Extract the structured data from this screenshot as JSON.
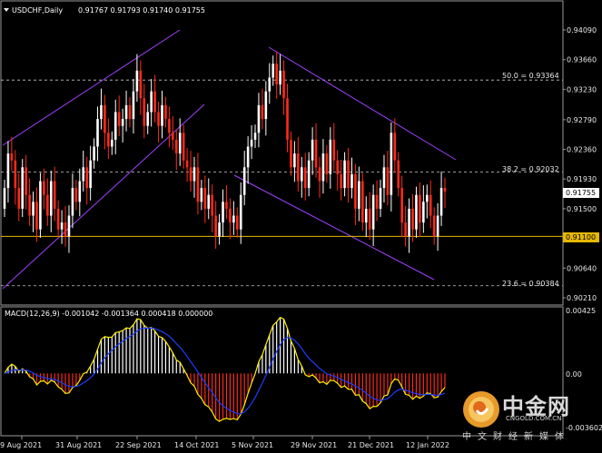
{
  "header": {
    "symbol": "USDCHF,Daily",
    "ohlc": "0.91767 0.91793 0.91740 0.91755",
    "collapse_icon": "triangle-down-icon"
  },
  "macd": {
    "label": "MACD(12,26,9) -0.001042 -0.001364 0.000418 0.000000",
    "scale_top": "0.00425",
    "scale_zero": "0.00",
    "scale_bottom": "-0.003602"
  },
  "fib": {
    "f50": "50.0 = 0.93364",
    "f38": "38.2 = 0.92032",
    "f23": "23.6 = 0.90384"
  },
  "price_axis": [
    "0.94090",
    "0.93660",
    "0.93230",
    "0.92790",
    "0.92360",
    "0.91930",
    "0.91500",
    "0.91060",
    "0.90640",
    "0.90210"
  ],
  "current_price": "0.91755",
  "support_price": "0.91100",
  "date_axis": [
    "9 Aug 2021",
    "31 Aug 2021",
    "22 Sep 2021",
    "14 Oct 2021",
    "5 Nov 2021",
    "29 Nov 2021",
    "21 Dec 2021",
    "12 Jan 2022"
  ],
  "colors": {
    "background": "#000000",
    "bull": "#ffffff",
    "bear": "#ff2a1a",
    "channel": "#a040ff",
    "support": "#e6b800",
    "macd_line": "#ffee00",
    "signal_line": "#1c3cff",
    "grid": "#c8c8c8"
  },
  "watermark": {
    "title": "中金网",
    "url": "CNGOLD.COM.CN",
    "subtitle": "中文财经新媒体"
  },
  "chart_data": {
    "type": "candlestick",
    "series": [
      {
        "name": "USDCHF,Daily",
        "close": [
          0.918,
          0.923,
          0.922,
          0.918,
          0.915,
          0.921,
          0.917,
          0.914,
          0.916,
          0.912,
          0.919,
          0.917,
          0.914,
          0.919,
          0.915,
          0.912,
          0.913,
          0.911,
          0.914,
          0.918,
          0.916,
          0.919,
          0.921,
          0.918,
          0.922,
          0.924,
          0.928,
          0.93,
          0.926,
          0.924,
          0.925,
          0.929,
          0.927,
          0.928,
          0.93,
          0.928,
          0.932,
          0.935,
          0.931,
          0.927,
          0.929,
          0.932,
          0.929,
          0.927,
          0.93,
          0.928,
          0.926,
          0.925,
          0.923,
          0.926,
          0.922,
          0.921,
          0.919,
          0.921,
          0.916,
          0.918,
          0.915,
          0.917,
          0.914,
          0.911,
          0.913,
          0.916,
          0.915,
          0.913,
          0.914,
          0.912,
          0.917,
          0.921,
          0.924,
          0.925,
          0.926,
          0.93,
          0.928,
          0.932,
          0.934,
          0.936,
          0.933,
          0.935,
          0.931,
          0.925,
          0.921,
          0.923,
          0.919,
          0.921,
          0.918,
          0.922,
          0.925,
          0.921,
          0.919,
          0.923,
          0.92,
          0.925,
          0.922,
          0.92,
          0.918,
          0.922,
          0.918,
          0.92,
          0.915,
          0.919,
          0.913,
          0.915,
          0.912,
          0.917,
          0.915,
          0.918,
          0.921,
          0.917,
          0.926,
          0.922,
          0.918,
          0.913,
          0.911,
          0.915,
          0.912,
          0.917,
          0.913,
          0.916,
          0.917,
          0.914,
          0.911,
          0.914,
          0.918,
          0.9175
        ]
      }
    ],
    "fibonacci_levels": [
      {
        "label": "50.0",
        "value": 0.93364
      },
      {
        "label": "38.2",
        "value": 0.92032
      },
      {
        "label": "23.6",
        "value": 0.90384
      }
    ],
    "horizontal_level": 0.911,
    "y_ticks": [
      0.9409,
      0.9366,
      0.9323,
      0.9279,
      0.9236,
      0.9193,
      0.915,
      0.9106,
      0.9064,
      0.9021
    ],
    "x_ticks": [
      "9 Aug 2021",
      "31 Aug 2021",
      "22 Sep 2021",
      "14 Oct 2021",
      "5 Nov 2021",
      "29 Nov 2021",
      "21 Dec 2021",
      "12 Jan 2022"
    ],
    "macd": {
      "fast": 12,
      "slow": 26,
      "signal": 9,
      "ylim": [
        -0.003602,
        0.00425
      ]
    }
  }
}
